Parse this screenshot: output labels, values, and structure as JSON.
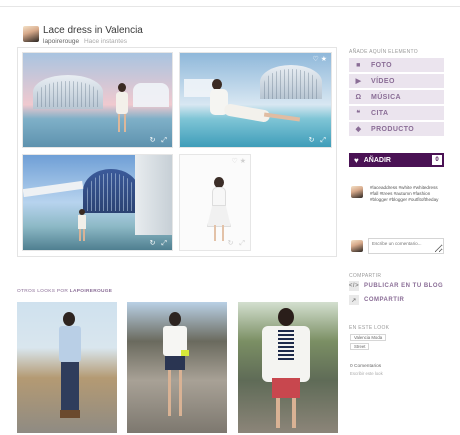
{
  "look": {
    "title": "Lace dress in Valencia",
    "username": "lapoirerouge",
    "time": "Hace instantes"
  },
  "grid": {
    "corner_icons": "♡ ★",
    "tile_icons": "↻ ⤢"
  },
  "sidebar": {
    "add_heading": "AÑADE AQUÍN ELEMENTO",
    "media_buttons": [
      {
        "label": "FOTO",
        "icon": "camera-icon"
      },
      {
        "label": "VÍDEO",
        "icon": "video-icon"
      },
      {
        "label": "MÚSICA",
        "icon": "headphones-icon"
      },
      {
        "label": "CITA",
        "icon": "quote-icon"
      },
      {
        "label": "PRODUCTO",
        "icon": "tag-icon"
      }
    ],
    "like": {
      "label": "AÑADIR",
      "count": "0"
    },
    "tags_text": "#laceaddress #white #whitedress #fall #trees #autumn #fashion #blogger #blogger #outfitoftheday",
    "comment_placeholder": "Escribe un comentario...",
    "share_heading": "COMPARTIR",
    "share_actions": [
      {
        "label": "PUBLICAR EN TU BLOG",
        "icon": "code-icon"
      },
      {
        "label": "COMPARTIR",
        "icon": "share-icon"
      }
    ],
    "in_this_look_heading": "EN ESTE LOOK",
    "chips": [
      "Valencia Moda",
      "Street"
    ],
    "comments_count": "0 Comentarios",
    "comments_sub": "Escribir este look"
  },
  "other_looks": {
    "heading_prefix": "OTROS LOOKS POR",
    "heading_user": "LAPOIREROUGE"
  },
  "colors": {
    "accent": "#4a1254",
    "button_bg": "#ebe4ee",
    "button_text": "#8a6d96"
  }
}
